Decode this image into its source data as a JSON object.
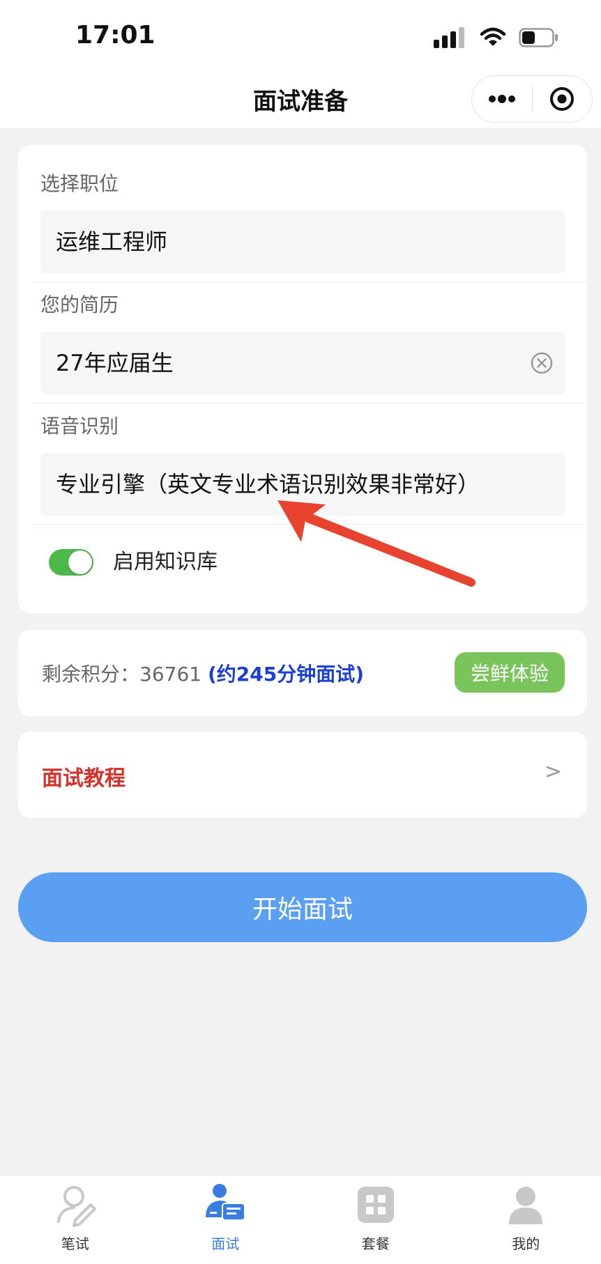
{
  "status_bar": {
    "time": "17:01"
  },
  "nav": {
    "title": "面试准备"
  },
  "form": {
    "position": {
      "label": "选择职位",
      "value": "运维工程师"
    },
    "resume": {
      "label": "您的简历",
      "value": "27年应届生"
    },
    "speech": {
      "label": "语音识别",
      "value": "专业引擎（英文专业术语识别效果非常好）"
    },
    "knowledge_base": {
      "label": "启用知识库",
      "enabled": true
    }
  },
  "points": {
    "label": "剩余积分：",
    "value": "36761",
    "minutes": "(约245分钟面试)",
    "trial_button": "尝鲜体验"
  },
  "tutorial": {
    "title": "面试教程",
    "chevron": ">"
  },
  "start_button": "开始面试",
  "tabs": [
    {
      "label": "笔试",
      "icon": "pen-user-icon",
      "active": false
    },
    {
      "label": "面试",
      "icon": "interview-icon",
      "active": true
    },
    {
      "label": "套餐",
      "icon": "grid-icon",
      "active": false
    },
    {
      "label": "我的",
      "icon": "profile-icon",
      "active": false
    }
  ],
  "colors": {
    "accent_blue": "#5b9ff2",
    "toggle_green": "#4cb84a",
    "trial_green": "#7ac45c",
    "tutorial_red": "#d8302a",
    "minutes_blue": "#1a3fd6",
    "annotation_arrow": "#e8432e"
  }
}
